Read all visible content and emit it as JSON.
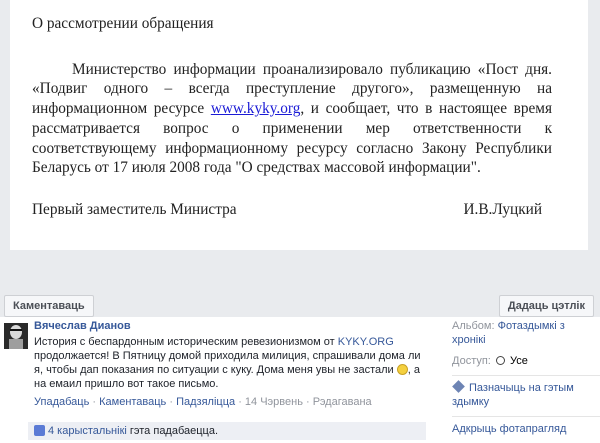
{
  "letter": {
    "heading": "О рассмотрении обращения",
    "paragraph_before_link": "Министерство информации проанализировало публикацию «Пост дня. «Подвиг одного – всегда преступление другого», размещенную на информационном ресурсе ",
    "link_text": "www.kyky.org",
    "paragraph_after_link": ", и сообщает, что в настоящее время рассматривается вопрос о применении мер ответственности к соответствующему информационному ресурсу согласно Закону Республики Беларусь от 17 июля 2008 года \"О средствах массовой информации\".",
    "signature_title": "Первый заместитель Министра",
    "signature_name": "И.В.Луцкий"
  },
  "actions": {
    "comment_button": "Каментаваць",
    "add_tag_button": "Дадаць цэтлік"
  },
  "comment": {
    "author": "Вячеслав Дианов",
    "text_part1": "История с беспардонным историческим ревезионизмом от ",
    "text_link": "KYKY.ORG",
    "text_part2": " продолжается! В Пятницу домой приходила милиция, спрашивали дома ли я, чтобы дап показания по ситуации с куку. Дома меня увы не застали ",
    "text_part3": ", а на емаил пришло вот такое письмо.",
    "meta_like": "Упадабаць",
    "meta_comment": "Каментаваць",
    "meta_share": "Падзяліцца",
    "meta_date": "14 Чэрвень",
    "meta_edit": "Рэдагавана",
    "separator": "·"
  },
  "likes": {
    "count_text": "4 карыстальнікі",
    "suffix": " гэта падабаецца."
  },
  "sidebar": {
    "album_label": "Альбом:",
    "album_value": "Фотаздымкі з хронікі",
    "access_label": "Доступ:",
    "access_value": "Усе",
    "tag_action": "Пазначыць на гэтым здымку",
    "photo_address": "Адкрыць фотапрагляд"
  },
  "colors": {
    "link": "#365899",
    "backdrop": "#e9ebee",
    "likes_bg": "#edeff4"
  }
}
